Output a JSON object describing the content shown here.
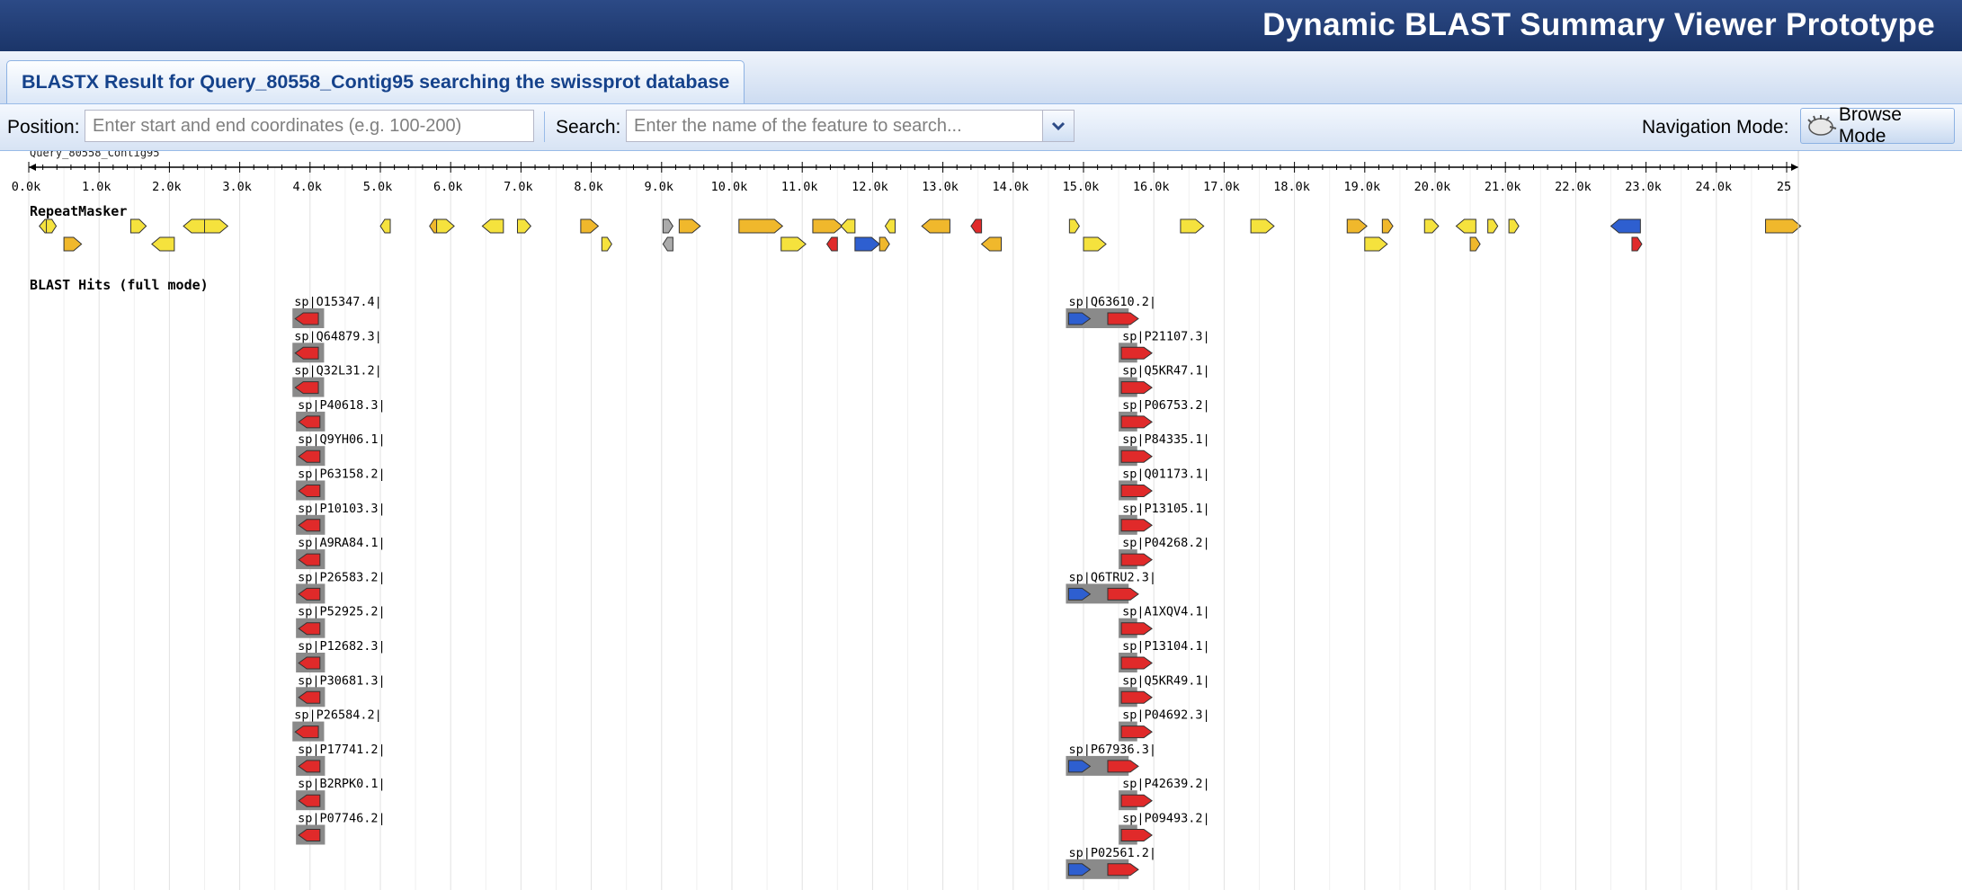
{
  "app": {
    "title": "Dynamic BLAST Summary Viewer Prototype"
  },
  "tab": {
    "label": "BLASTX Result for Query_80558_Contig95 searching the swissprot database"
  },
  "toolbar": {
    "position_label": "Position:",
    "position_placeholder": "Enter start and end coordinates (e.g. 100-200)",
    "position_value": "",
    "search_label": "Search:",
    "search_placeholder": "Enter the name of the feature to search...",
    "search_value": "",
    "nav_mode_label": "Navigation Mode:",
    "browse_mode_label": "Browse Mode"
  },
  "ruler": {
    "query_name": "Query_80558_Contig95",
    "ticks": [
      "0.0k",
      "1.0k",
      "2.0k",
      "3.0k",
      "4.0k",
      "5.0k",
      "6.0k",
      "7.0k",
      "8.0k",
      "9.0k",
      "10.0k",
      "11.0k",
      "12.0k",
      "13.0k",
      "14.0k",
      "15.0k",
      "16.0k",
      "17.0k",
      "18.0k",
      "19.0k",
      "20.0k",
      "21.0k",
      "22.0k",
      "23.0k",
      "24.0k",
      "25"
    ]
  },
  "tracks": {
    "repeatmasker_label": "RepeatMasker",
    "blast_label": "BLAST Hits (full mode)"
  },
  "colors": {
    "yellow": "#f5e23d",
    "orange": "#f0b82c",
    "red": "#e02a2a",
    "blue": "#2e5fd0",
    "gray_box": "#8a8a8a"
  },
  "repeats": [
    {
      "pos": 150,
      "len": 180,
      "dir": "left",
      "row": 0,
      "color": "yellow"
    },
    {
      "pos": 250,
      "len": 120,
      "dir": "right",
      "row": 0,
      "color": "yellow"
    },
    {
      "pos": 500,
      "len": 250,
      "dir": "right",
      "row": 1,
      "color": "orange"
    },
    {
      "pos": 1450,
      "len": 220,
      "dir": "right",
      "row": 0,
      "color": "yellow"
    },
    {
      "pos": 1750,
      "len": 320,
      "dir": "left",
      "row": 1,
      "color": "yellow"
    },
    {
      "pos": 2200,
      "len": 320,
      "dir": "left",
      "row": 0,
      "color": "yellow"
    },
    {
      "pos": 2500,
      "len": 330,
      "dir": "right",
      "row": 0,
      "color": "yellow"
    },
    {
      "pos": 5000,
      "len": 120,
      "dir": "left",
      "row": 0,
      "color": "yellow"
    },
    {
      "pos": 5700,
      "len": 80,
      "dir": "left",
      "row": 0,
      "color": "orange"
    },
    {
      "pos": 5800,
      "len": 250,
      "dir": "right",
      "row": 0,
      "color": "yellow"
    },
    {
      "pos": 6450,
      "len": 300,
      "dir": "left",
      "row": 0,
      "color": "yellow"
    },
    {
      "pos": 6950,
      "len": 190,
      "dir": "right",
      "row": 0,
      "color": "yellow"
    },
    {
      "pos": 7850,
      "len": 250,
      "dir": "right",
      "row": 0,
      "color": "orange"
    },
    {
      "pos": 8150,
      "len": 130,
      "dir": "right",
      "row": 1,
      "color": "yellow"
    },
    {
      "pos": 9020,
      "len": 90,
      "dir": "right",
      "row": 0,
      "color": "gray"
    },
    {
      "pos": 9020,
      "len": 90,
      "dir": "left",
      "row": 1,
      "color": "gray"
    },
    {
      "pos": 9250,
      "len": 300,
      "dir": "right",
      "row": 0,
      "color": "orange"
    },
    {
      "pos": 10100,
      "len": 620,
      "dir": "right",
      "row": 0,
      "color": "orange"
    },
    {
      "pos": 10700,
      "len": 350,
      "dir": "right",
      "row": 1,
      "color": "yellow"
    },
    {
      "pos": 11150,
      "len": 420,
      "dir": "right",
      "row": 0,
      "color": "orange"
    },
    {
      "pos": 11550,
      "len": 200,
      "dir": "left",
      "row": 0,
      "color": "yellow"
    },
    {
      "pos": 11350,
      "len": 150,
      "dir": "left",
      "row": 1,
      "color": "red"
    },
    {
      "pos": 11750,
      "len": 350,
      "dir": "right",
      "row": 1,
      "color": "blue"
    },
    {
      "pos": 12100,
      "len": 90,
      "dir": "right",
      "row": 1,
      "color": "orange"
    },
    {
      "pos": 12180,
      "len": 80,
      "dir": "left",
      "row": 0,
      "color": "yellow"
    },
    {
      "pos": 12700,
      "len": 400,
      "dir": "left",
      "row": 0,
      "color": "orange"
    },
    {
      "pos": 13400,
      "len": 150,
      "dir": "left",
      "row": 0,
      "color": "red"
    },
    {
      "pos": 13550,
      "len": 280,
      "dir": "left",
      "row": 1,
      "color": "orange"
    },
    {
      "pos": 14800,
      "len": 120,
      "dir": "right",
      "row": 0,
      "color": "yellow"
    },
    {
      "pos": 15000,
      "len": 320,
      "dir": "right",
      "row": 1,
      "color": "yellow"
    },
    {
      "pos": 16380,
      "len": 330,
      "dir": "right",
      "row": 0,
      "color": "yellow"
    },
    {
      "pos": 17380,
      "len": 330,
      "dir": "right",
      "row": 0,
      "color": "yellow"
    },
    {
      "pos": 18750,
      "len": 280,
      "dir": "right",
      "row": 0,
      "color": "orange"
    },
    {
      "pos": 19000,
      "len": 320,
      "dir": "right",
      "row": 1,
      "color": "yellow"
    },
    {
      "pos": 19250,
      "len": 150,
      "dir": "right",
      "row": 0,
      "color": "orange"
    },
    {
      "pos": 19850,
      "len": 200,
      "dir": "right",
      "row": 0,
      "color": "yellow"
    },
    {
      "pos": 20300,
      "len": 280,
      "dir": "left",
      "row": 0,
      "color": "yellow"
    },
    {
      "pos": 20500,
      "len": 120,
      "dir": "right",
      "row": 1,
      "color": "orange"
    },
    {
      "pos": 20750,
      "len": 120,
      "dir": "right",
      "row": 0,
      "color": "yellow"
    },
    {
      "pos": 21050,
      "len": 100,
      "dir": "right",
      "row": 0,
      "color": "yellow"
    },
    {
      "pos": 22500,
      "len": 420,
      "dir": "left",
      "row": 0,
      "color": "blue"
    },
    {
      "pos": 22800,
      "len": 140,
      "dir": "right",
      "row": 1,
      "color": "red"
    },
    {
      "pos": 24700,
      "len": 500,
      "dir": "right",
      "row": 0,
      "color": "orange"
    }
  ],
  "hits_left": [
    {
      "label": "sp|O15347.4|",
      "pos": 3750,
      "len": 600,
      "dir": "left"
    },
    {
      "label": "sp|Q64879.3|",
      "pos": 3750,
      "len": 600,
      "dir": "left"
    },
    {
      "label": "sp|Q32L31.2|",
      "pos": 3750,
      "len": 600,
      "dir": "left"
    },
    {
      "label": "sp|P40618.3|",
      "pos": 3800,
      "len": 550,
      "dir": "left"
    },
    {
      "label": "sp|Q9YH06.1|",
      "pos": 3800,
      "len": 550,
      "dir": "left"
    },
    {
      "label": "sp|P63158.2|",
      "pos": 3800,
      "len": 550,
      "dir": "left"
    },
    {
      "label": "sp|P10103.3|",
      "pos": 3800,
      "len": 550,
      "dir": "left"
    },
    {
      "label": "sp|A9RA84.1|",
      "pos": 3800,
      "len": 550,
      "dir": "left"
    },
    {
      "label": "sp|P26583.2|",
      "pos": 3800,
      "len": 550,
      "dir": "left"
    },
    {
      "label": "sp|P52925.2|",
      "pos": 3800,
      "len": 550,
      "dir": "left"
    },
    {
      "label": "sp|P12682.3|",
      "pos": 3800,
      "len": 550,
      "dir": "left"
    },
    {
      "label": "sp|P30681.3|",
      "pos": 3800,
      "len": 550,
      "dir": "left"
    },
    {
      "label": "sp|P26584.2|",
      "pos": 3750,
      "len": 600,
      "dir": "left"
    },
    {
      "label": "sp|P17741.2|",
      "pos": 3800,
      "len": 550,
      "dir": "left"
    },
    {
      "label": "sp|B2RPK0.1|",
      "pos": 3800,
      "len": 550,
      "dir": "left"
    },
    {
      "label": "sp|P07746.2|",
      "pos": 3800,
      "len": 550,
      "dir": "left"
    }
  ],
  "hits_right": [
    {
      "label": "sp|Q63610.2|",
      "pos": 14750,
      "len": 850,
      "blue": true
    },
    {
      "label": "sp|P21107.3|",
      "pos": 15500,
      "len": 480,
      "blue": false
    },
    {
      "label": "sp|Q5KR47.1|",
      "pos": 15500,
      "len": 480,
      "blue": false
    },
    {
      "label": "sp|P06753.2|",
      "pos": 15500,
      "len": 480,
      "blue": false
    },
    {
      "label": "sp|P84335.1|",
      "pos": 15500,
      "len": 480,
      "blue": false
    },
    {
      "label": "sp|Q01173.1|",
      "pos": 15500,
      "len": 480,
      "blue": false
    },
    {
      "label": "sp|P13105.1|",
      "pos": 15500,
      "len": 480,
      "blue": false
    },
    {
      "label": "sp|P04268.2|",
      "pos": 15500,
      "len": 480,
      "blue": false
    },
    {
      "label": "sp|Q6TRU2.3|",
      "pos": 14750,
      "len": 850,
      "blue": true
    },
    {
      "label": "sp|A1XQV4.1|",
      "pos": 15500,
      "len": 480,
      "blue": false
    },
    {
      "label": "sp|P13104.1|",
      "pos": 15500,
      "len": 480,
      "blue": false
    },
    {
      "label": "sp|Q5KR49.1|",
      "pos": 15500,
      "len": 480,
      "blue": false
    },
    {
      "label": "sp|P04692.3|",
      "pos": 15500,
      "len": 480,
      "blue": false
    },
    {
      "label": "sp|P67936.3|",
      "pos": 14750,
      "len": 850,
      "blue": true
    },
    {
      "label": "sp|P42639.2|",
      "pos": 15500,
      "len": 480,
      "blue": false
    },
    {
      "label": "sp|P09493.2|",
      "pos": 15500,
      "len": 480,
      "blue": false
    },
    {
      "label": "sp|P02561.2|",
      "pos": 14750,
      "len": 850,
      "blue": true
    }
  ]
}
